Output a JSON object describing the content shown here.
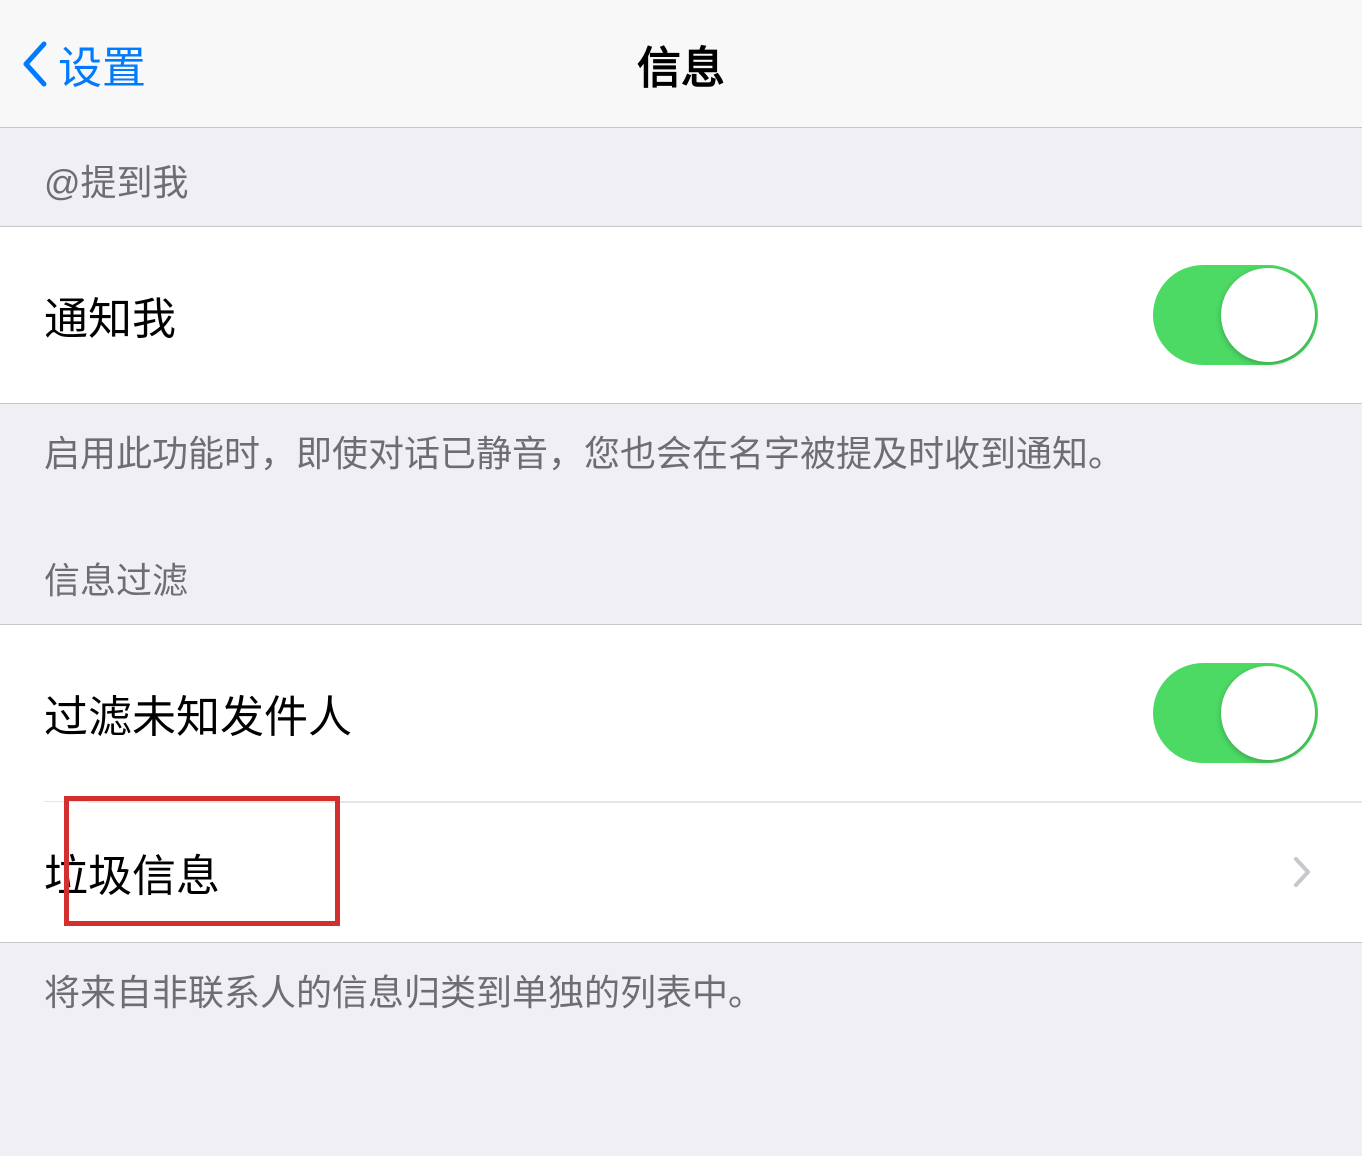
{
  "navbar": {
    "back_label": "设置",
    "title": "信息"
  },
  "sections": {
    "mentions": {
      "header": "@提到我",
      "notify_me_label": "通知我",
      "notify_me_on": true,
      "footer": "启用此功能时，即使对话已静音，您也会在名字被提及时收到通知。"
    },
    "filter": {
      "header": "信息过滤",
      "filter_unknown_label": "过滤未知发件人",
      "filter_unknown_on": true,
      "junk_label": "垃圾信息",
      "footer": "将来自非联系人的信息归类到单独的列表中。"
    }
  }
}
